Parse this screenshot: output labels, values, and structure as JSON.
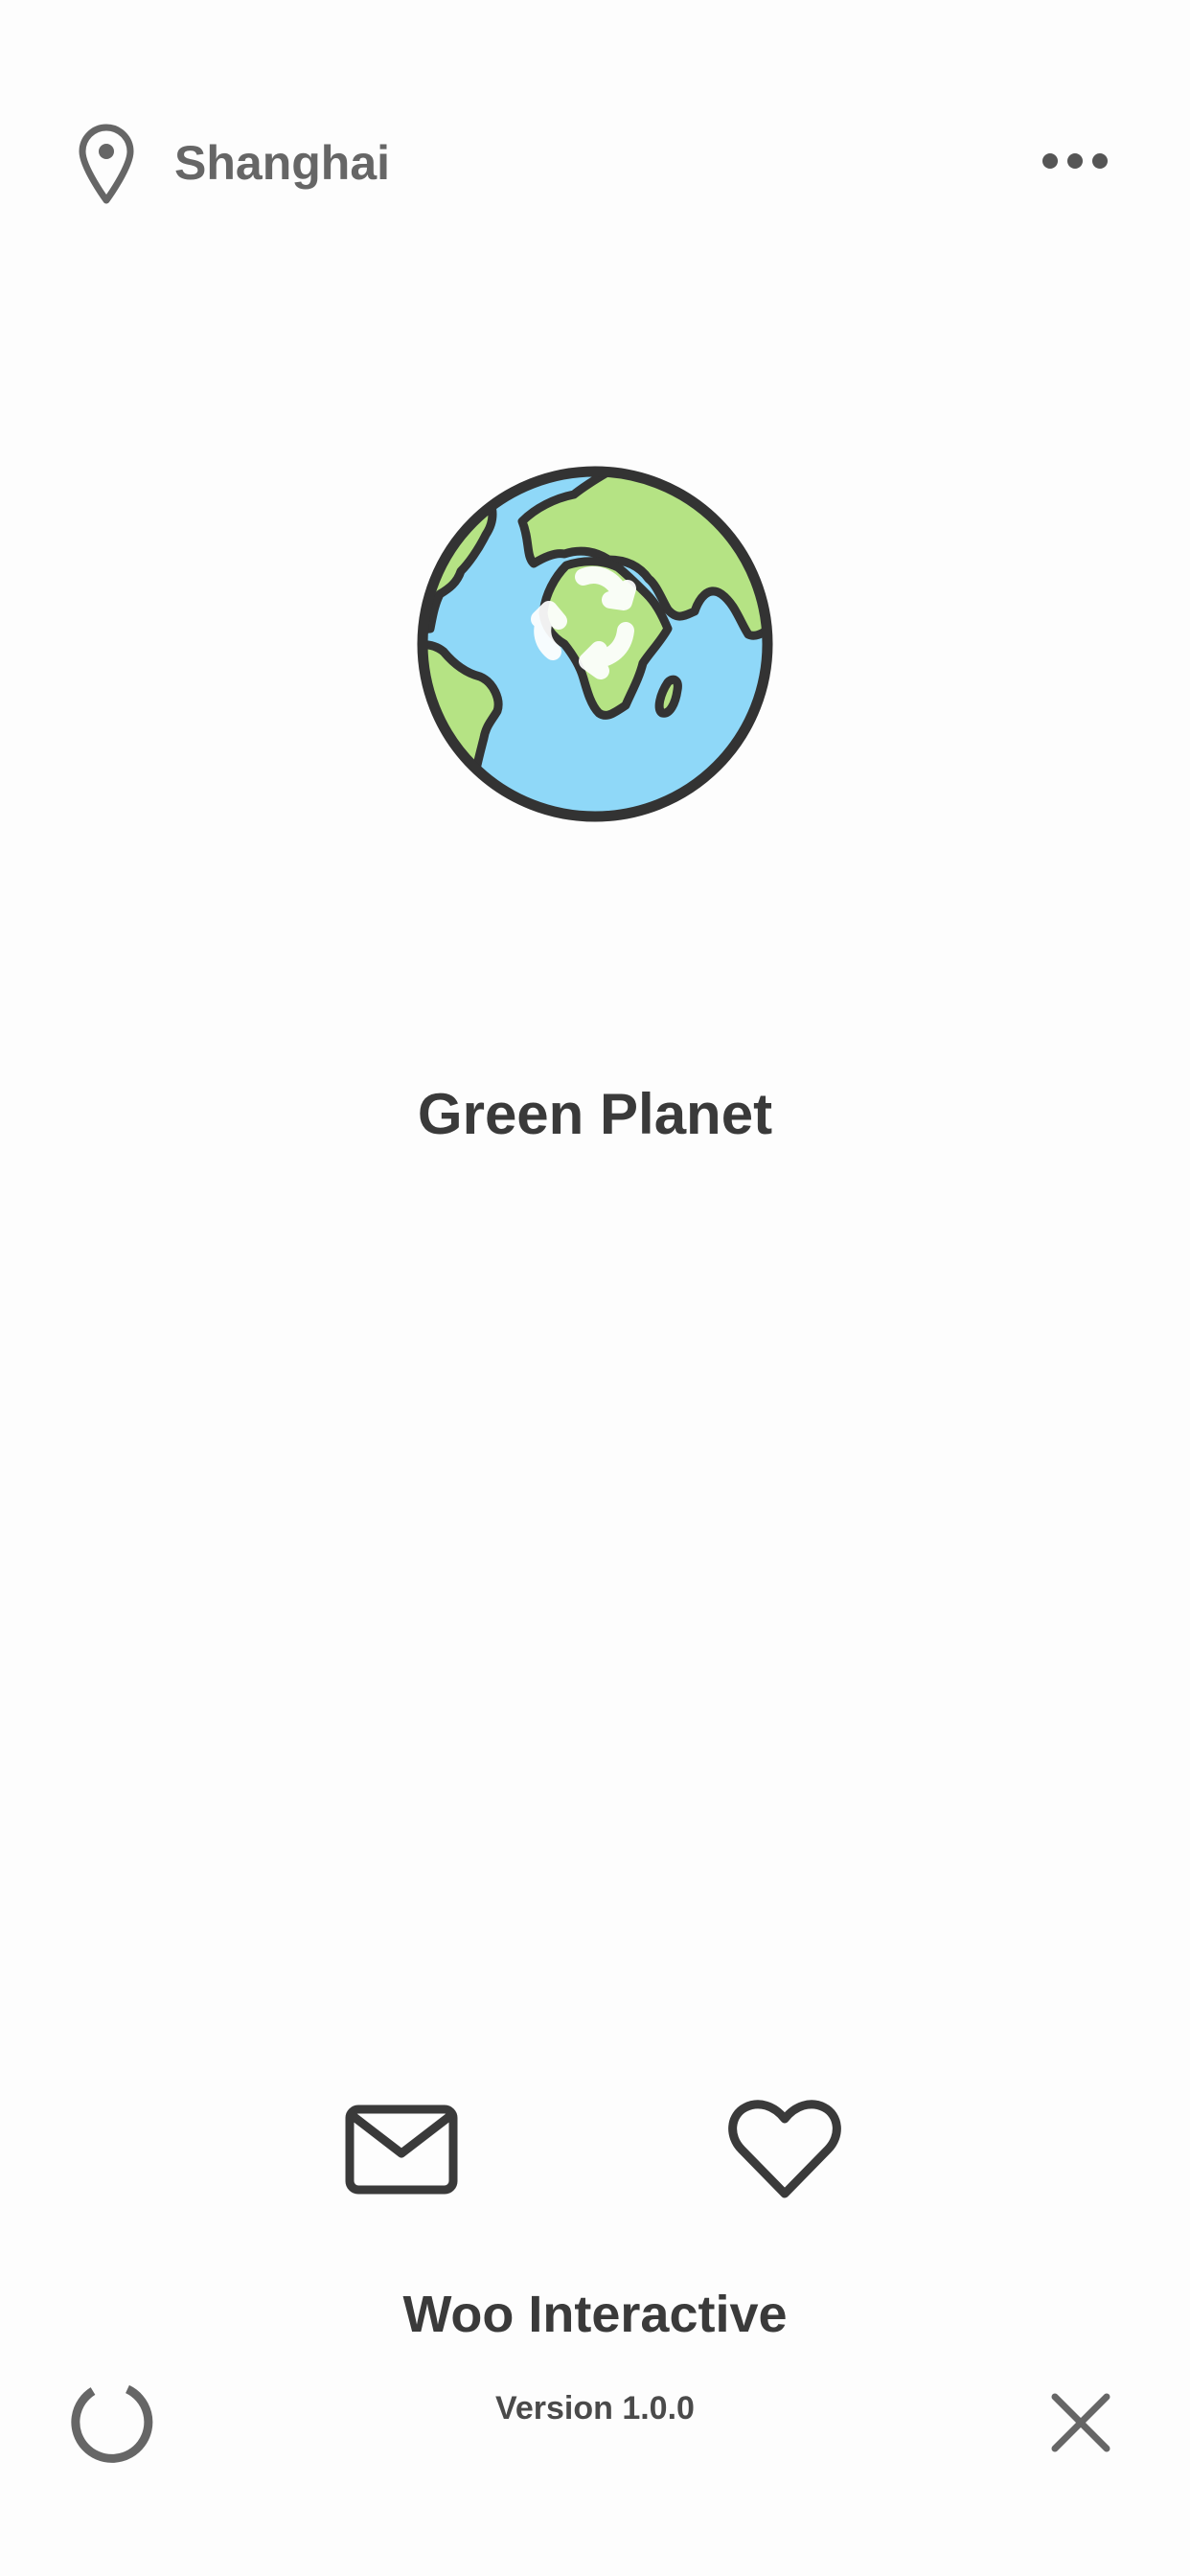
{
  "header": {
    "location_label": "Shanghai",
    "location_icon": "map-pin-icon",
    "more_icon": "more-horizontal-icon"
  },
  "hero": {
    "icon": "recycling-globe-icon",
    "title": "Green Planet"
  },
  "actions": {
    "mail_icon": "mail-icon",
    "heart_icon": "heart-icon"
  },
  "footer": {
    "company": "Woo Interactive",
    "version": "Version 1.0.0",
    "refresh_icon": "refresh-icon",
    "close_icon": "close-icon"
  },
  "colors": {
    "text_dark": "#3a3a3a",
    "text_gray": "#666666",
    "ocean": "#8fd8f8",
    "land": "#b5e384",
    "outline": "#333333"
  }
}
